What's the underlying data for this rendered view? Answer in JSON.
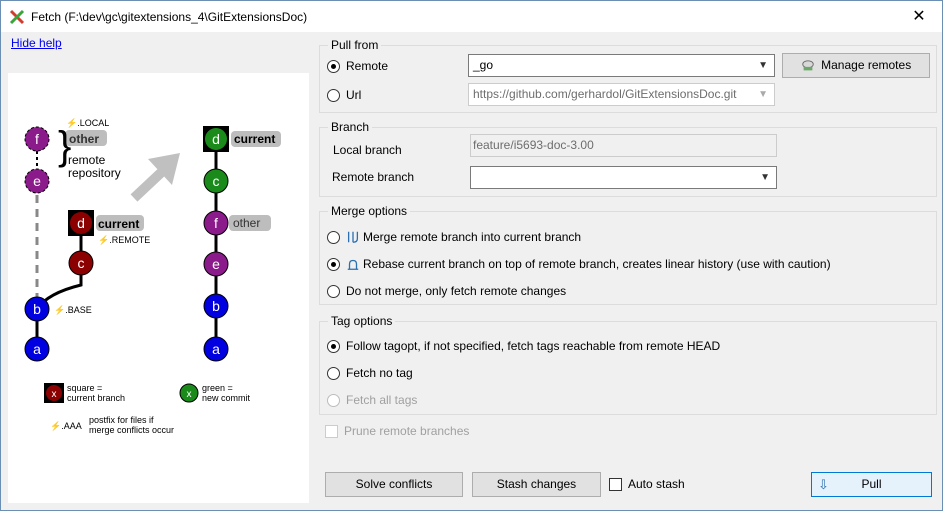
{
  "window": {
    "title": "Fetch (F:\\dev\\gc\\gitextensions_4\\GitExtensionsDoc)",
    "close_glyph": "✕"
  },
  "help": {
    "hide_link": "Hide help",
    "local_label": "⚡.LOCAL",
    "remote_label": "⚡.REMOTE",
    "base_label": "⚡.BASE",
    "aaa_label": "⚡.AAA",
    "other": "other",
    "current": "current",
    "remote_repository": [
      "remote",
      "repository"
    ],
    "nodes": {
      "f": "f",
      "e": "e",
      "d": "d",
      "c": "c",
      "b": "b",
      "a": "a"
    },
    "legend_square": [
      "square =",
      "current branch"
    ],
    "legend_green": [
      "green =",
      "new commit"
    ],
    "legend_postfix": [
      "postfix for files if",
      "merge conflicts occur"
    ],
    "legend_x": "x"
  },
  "pull_from": {
    "legend": "Pull from",
    "remote_label": "Remote",
    "remote_value": "_go",
    "url_label": "Url",
    "url_value": "https://github.com/gerhardol/GitExtensionsDoc.git",
    "manage_remotes": "Manage remotes"
  },
  "branch": {
    "legend": "Branch",
    "local_label": "Local branch",
    "local_value": "feature/i5693-doc-3.00",
    "remote_label": "Remote branch",
    "remote_value": ""
  },
  "merge_options": {
    "legend": "Merge options",
    "merge": "Merge remote branch into current branch",
    "rebase": "Rebase current branch on top of remote branch, creates linear history (use with caution)",
    "fetch_only": "Do not merge, only fetch remote changes"
  },
  "tag_options": {
    "legend": "Tag options",
    "follow": "Follow tagopt, if not specified, fetch tags reachable from remote HEAD",
    "no_tag": "Fetch no tag",
    "all_tags": "Fetch all tags"
  },
  "prune": "Prune remote branches",
  "buttons": {
    "solve_conflicts": "Solve conflicts",
    "stash_changes": "Stash changes",
    "auto_stash": "Auto stash",
    "pull": "Pull"
  },
  "colors": {
    "purple": "#8b1a8b",
    "red": "#8b0000",
    "green": "#1a8b1a",
    "blue": "#0000e0"
  }
}
